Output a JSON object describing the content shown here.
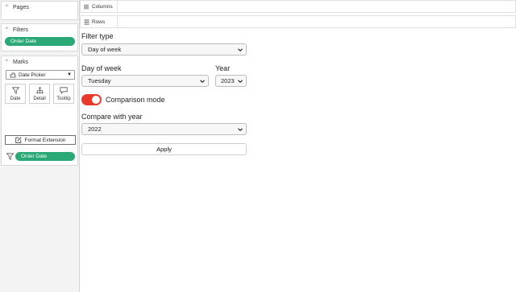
{
  "sidebar": {
    "pages": {
      "title": "Pages"
    },
    "filters": {
      "title": "Filters",
      "items": [
        "Order Date"
      ]
    },
    "marks": {
      "title": "Marks",
      "mark_type": "Date Picker",
      "buttons": [
        "Date",
        "Detail",
        "Tooltip"
      ],
      "format_label": "Format Extension",
      "filter_pill": "Order Date"
    }
  },
  "shelves": {
    "columns": "Columns",
    "rows": "Rows"
  },
  "panel": {
    "filter_type_label": "Filter type",
    "filter_type_value": "Day of week",
    "day_of_week_label": "Day of week",
    "day_of_week_value": "Tuesday",
    "year_label": "Year",
    "year_value": "2023",
    "comparison_label": "Comparison mode",
    "comparison_on": true,
    "compare_year_label": "Compare with year",
    "compare_year_value": "2022",
    "apply_label": "Apply"
  },
  "colors": {
    "pill": "#2aa876",
    "toggle_on": "#e8392c"
  }
}
